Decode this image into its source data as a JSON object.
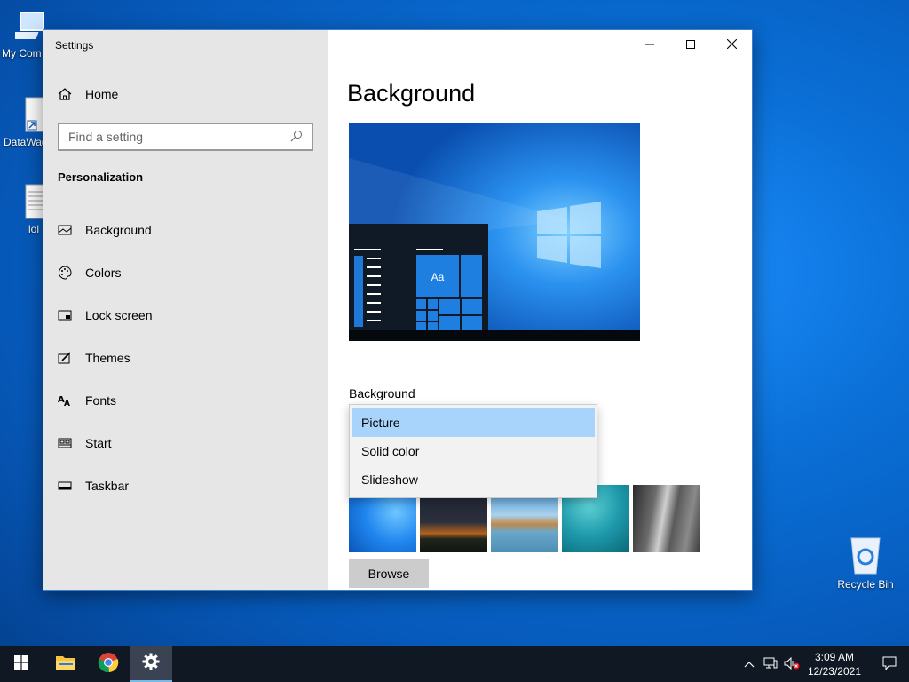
{
  "desktop": {
    "icons": [
      {
        "label": "My Com"
      },
      {
        "label": "DataWag"
      },
      {
        "label": "lol"
      },
      {
        "label": "Recycle Bin"
      }
    ]
  },
  "window": {
    "title": "Settings",
    "home_label": "Home",
    "search_placeholder": "Find a setting",
    "section_title": "Personalization",
    "nav": [
      {
        "label": "Background",
        "icon": "picture-icon"
      },
      {
        "label": "Colors",
        "icon": "palette-icon"
      },
      {
        "label": "Lock screen",
        "icon": "lock-screen-icon"
      },
      {
        "label": "Themes",
        "icon": "themes-icon"
      },
      {
        "label": "Fonts",
        "icon": "fonts-icon"
      },
      {
        "label": "Start",
        "icon": "start-icon"
      },
      {
        "label": "Taskbar",
        "icon": "taskbar-icon"
      }
    ]
  },
  "content": {
    "page_title": "Background",
    "preview_sample_text": "Aa",
    "background_label": "Background",
    "dropdown": {
      "options": [
        "Picture",
        "Solid color",
        "Slideshow"
      ],
      "selected": "Picture"
    },
    "browse_label": "Browse"
  },
  "taskbar": {
    "time": "3:09 AM",
    "date": "12/23/2021"
  },
  "colors": {
    "accent": "#0078d7",
    "dropdown_selected": "#a8d4fb",
    "sidebar_bg": "#e6e6e6",
    "taskbar_bg": "#101823"
  }
}
